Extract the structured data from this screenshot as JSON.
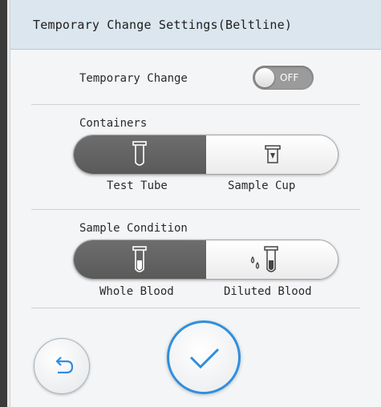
{
  "dialog": {
    "title": "Temporary Change Settings(Beltline)"
  },
  "temporary_change": {
    "label": "Temporary Change",
    "toggle_state": "OFF"
  },
  "containers": {
    "label": "Containers",
    "options": [
      {
        "label": "Test Tube",
        "selected": true,
        "icon": "test-tube-icon"
      },
      {
        "label": "Sample Cup",
        "selected": false,
        "icon": "sample-cup-icon"
      }
    ]
  },
  "sample_condition": {
    "label": "Sample Condition",
    "options": [
      {
        "label": "Whole Blood",
        "selected": true,
        "icon": "whole-blood-tube-icon"
      },
      {
        "label": "Diluted Blood",
        "selected": false,
        "icon": "diluted-blood-icon"
      }
    ]
  },
  "buttons": {
    "back_icon": "undo-arrow-icon",
    "ok_icon": "checkmark-icon"
  },
  "colors": {
    "header_bg": "#dbe6ef",
    "selected_segment": "#5f5f5f",
    "accent_blue": "#2f8ee0"
  }
}
